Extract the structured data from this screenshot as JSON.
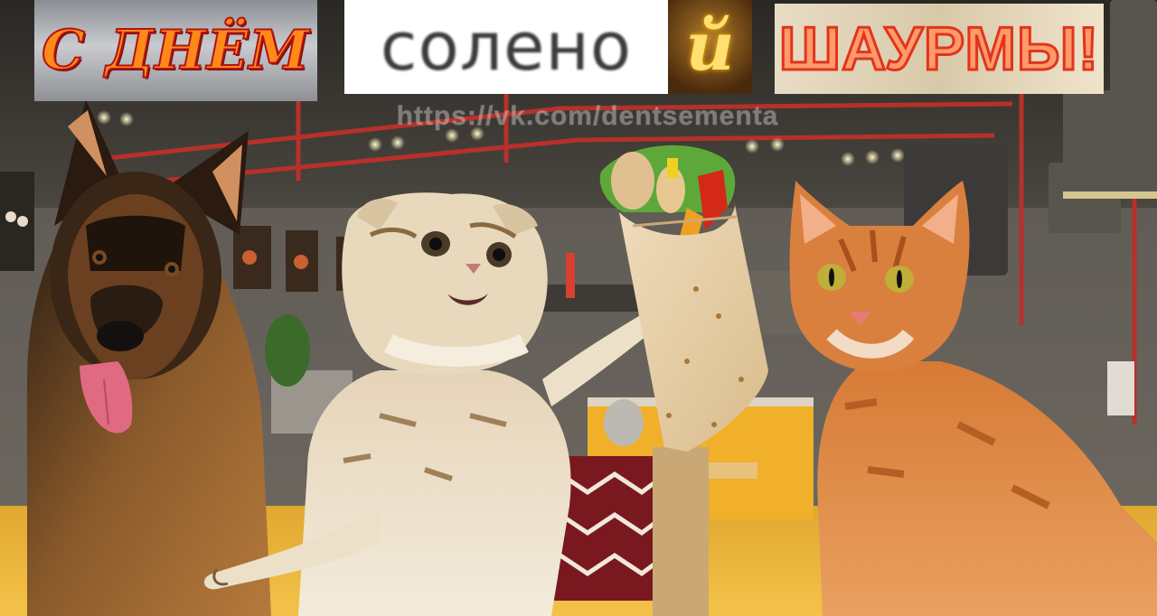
{
  "banners": {
    "part1": "С ДНЁМ",
    "part2": "солено",
    "part3": "й",
    "part4": "ШАУРМЫ!"
  },
  "watermark": "https://vk.com/dentsementa",
  "subjects": [
    "german-shepherd-dog",
    "scottish-fold-kitten",
    "shawarma-wrap",
    "ginger-cat"
  ],
  "colors": {
    "banner1_text": "#ff8a1a",
    "banner1_outline": "#b31212",
    "banner4_text": "#ff9a6a",
    "banner4_outline": "#e2341c",
    "cafe_accent_red": "#c8322a",
    "cafe_counter_yellow": "#f0b02a"
  }
}
